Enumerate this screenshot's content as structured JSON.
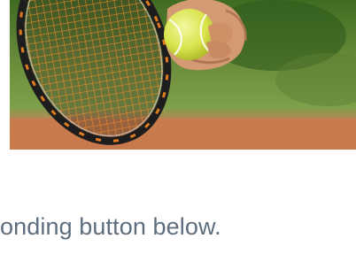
{
  "hero_image": {
    "subject": "tennis racket and ball",
    "icon": "tennis-photo"
  },
  "instruction_text": "onding button below.",
  "colors": {
    "text": "#5e6e7d",
    "clay_court": "#c97a4d",
    "background": "#ffffff"
  }
}
